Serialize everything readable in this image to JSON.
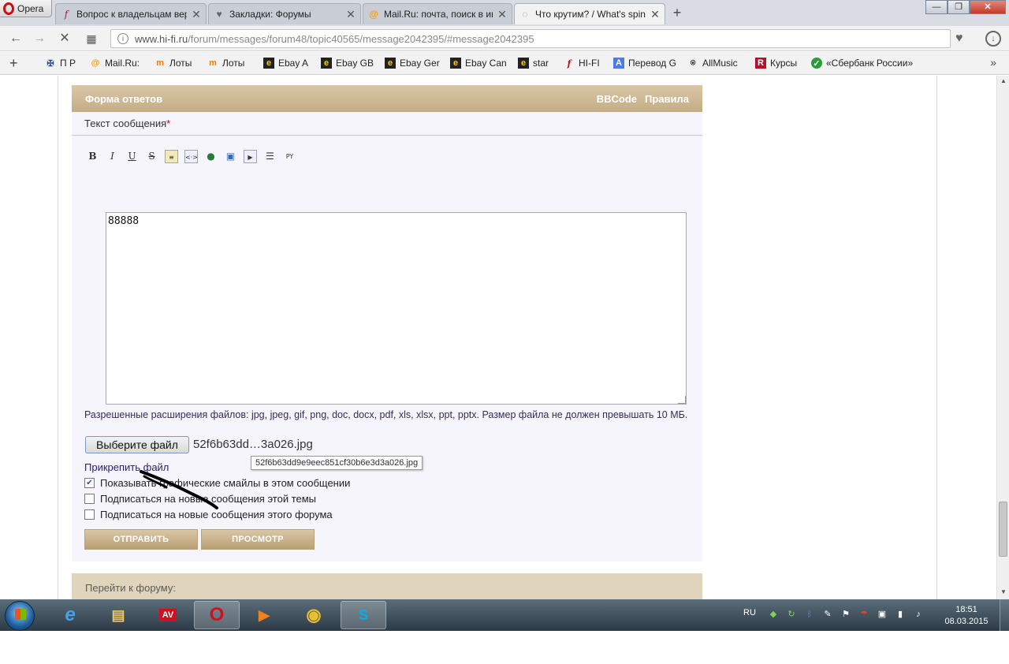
{
  "browser": {
    "opera_label": "Opera",
    "tabs": [
      {
        "title": "Вопрос к владельцам вер",
        "icon": "hifi-icon",
        "active": false
      },
      {
        "title": "Закладки: Форумы",
        "icon": "heart-icon",
        "active": false
      },
      {
        "title": "Mail.Ru: почта, поиск в ин",
        "icon": "mailru-icon",
        "active": false
      },
      {
        "title": "Что крутим? / What's spin",
        "icon": "loading-icon",
        "active": true
      }
    ],
    "url_domain": "www.hi-fi.ru",
    "url_path": "/forum/messages/forum48/topic40565/message2042395/#message2042395",
    "bookmarks": [
      {
        "label": "П Р",
        "icon": "eagle-icon"
      },
      {
        "label": "Mail.Ru:",
        "icon": "mailru-icon"
      },
      {
        "label": "Лоты",
        "icon": "molotok-icon"
      },
      {
        "label": "Лоты",
        "icon": "molotok-icon"
      },
      {
        "label": "Ebay A",
        "icon": "ebay-icon"
      },
      {
        "label": "Ebay GB",
        "icon": "ebay-icon"
      },
      {
        "label": "Ebay Ger",
        "icon": "ebay-icon"
      },
      {
        "label": "Ebay Can",
        "icon": "ebay-icon"
      },
      {
        "label": "star",
        "icon": "ebay-icon"
      },
      {
        "label": "HI-FI",
        "icon": "hifi-icon"
      },
      {
        "label": "Перевод G",
        "icon": "translate-icon"
      },
      {
        "label": "AllMusic",
        "icon": "allmusic-icon"
      },
      {
        "label": "Курсы",
        "icon": "rbc-icon"
      },
      {
        "label": "«Сбербанк России»",
        "icon": "sberbank-icon"
      }
    ]
  },
  "form": {
    "header_title": "Форма ответов",
    "header_link_bbcode": "BBCode",
    "header_link_rules": "Правила",
    "message_label": "Текст сообщения",
    "required_mark": "*",
    "toolbar": {
      "bold": "B",
      "italic": "I",
      "underline": "U",
      "strike": "S",
      "quote": "≡",
      "code": "<·>",
      "url": "●",
      "image": "▣",
      "video": "▶",
      "list": "☰",
      "translit": "PY"
    },
    "message_text": "88888",
    "allowed_text": "Разрешенные расширения файлов: jpg, jpeg, gif, png, doc, docx, pdf, xls, xlsx, ppt, pptx. Размер файла не должен превышать 10 МБ.",
    "choose_file_label": "Выберите файл",
    "chosen_file_short": "52f6b63dd…3a026.jpg",
    "chosen_file_tooltip": "52f6b63dd9e9eec851cf30b6e3d3a026.jpg",
    "attach_link": "Прикрепить файл",
    "options": [
      {
        "label": "Показывать графические смайлы в этом сообщении",
        "checked": true
      },
      {
        "label": "Подписаться на новые сообщения этой темы",
        "checked": false
      },
      {
        "label": "Подписаться на новые сообщения этого форума",
        "checked": false
      }
    ],
    "submit_label": "ОТПРАВИТЬ",
    "preview_label": "ПРОСМОТР"
  },
  "goto_forum_label": "Перейти к форуму:",
  "taskbar": {
    "lang": "RU",
    "time": "18:51",
    "date": "08.03.2015"
  }
}
